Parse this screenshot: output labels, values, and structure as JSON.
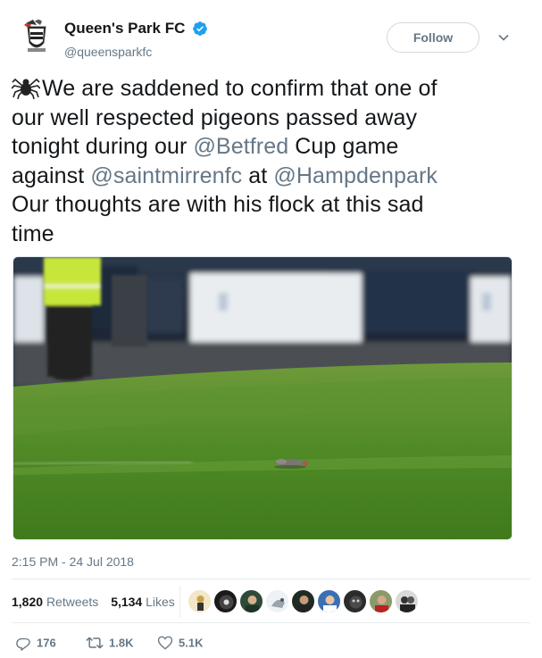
{
  "tweet": {
    "author": {
      "display_name": "Queen's Park FC",
      "handle": "@queensparkfc",
      "verified": true,
      "avatar_icon": "club-crest-icon"
    },
    "follow_label": "Follow",
    "text": {
      "line1_emoji": "spider-icon",
      "line1": "We are saddened to confirm that one of",
      "line2": "our well respected pigeons passed away",
      "line3_pre": "tonight during our ",
      "line3_mention": "@Betfred",
      "line3_post": " Cup game",
      "line4_pre": "against ",
      "line4_mention1": "@saintmirrenfc",
      "line4_mid": " at ",
      "line4_mention2": "@Hampdenpark",
      "line5": "Our thoughts are with his flock at this sad",
      "line6": "time"
    },
    "timestamp": "2:15 PM - 24 Jul 2018",
    "stats": {
      "retweets_count": "1,820",
      "retweets_label": "Retweets",
      "likes_count": "5,134",
      "likes_label": "Likes"
    },
    "actions": {
      "replies": "176",
      "retweets": "1.8K",
      "likes": "5.1K"
    }
  },
  "colors": {
    "mention": "#657786",
    "text": "#14171a",
    "verified": "#1da1f2",
    "muted": "#657786"
  }
}
